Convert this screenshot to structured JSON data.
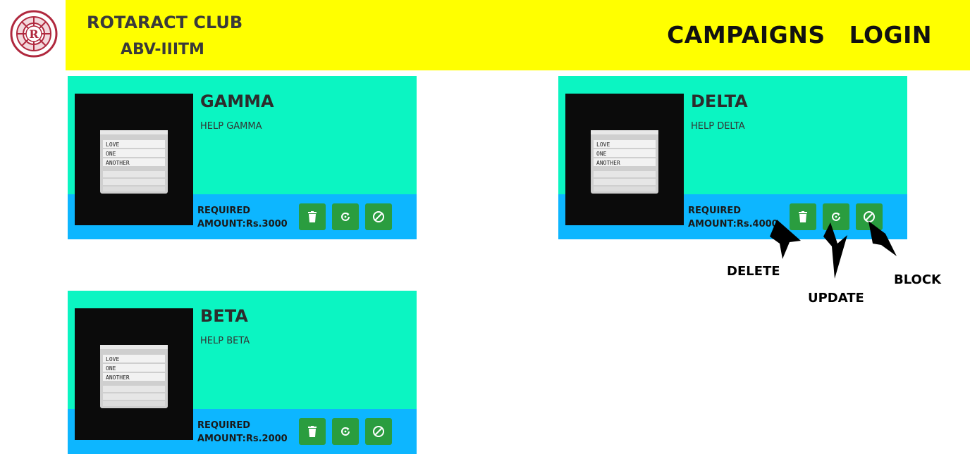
{
  "logo": {
    "icon": "rotaract-club-logo",
    "ring_text_top": "ROTARACT",
    "ring_text_bottom": "CLUB"
  },
  "header": {
    "brand_line1": "ROTARACT CLUB",
    "brand_line2": "ABV-IIITM",
    "nav": [
      {
        "label": "CAMPAIGNS"
      },
      {
        "label": "LOGIN"
      }
    ],
    "colors": {
      "background": "#ffff00"
    }
  },
  "campaigns": [
    {
      "title": "GAMMA",
      "description": "HELP GAMMA",
      "amount_line1": "REQUIRED",
      "amount_line2": "AMOUNT:Rs.3000"
    },
    {
      "title": "DELTA",
      "description": "HELP DELTA",
      "amount_line1": "REQUIRED",
      "amount_line2": "AMOUNT:Rs.4000"
    },
    {
      "title": "BETA",
      "description": "HELP BETA",
      "amount_line1": "REQUIRED",
      "amount_line2": "AMOUNT:Rs.2000"
    }
  ],
  "card_image_text": [
    "LOVE",
    "ONE",
    "ANOTHER"
  ],
  "actions": [
    {
      "name": "delete",
      "icon": "trash-icon"
    },
    {
      "name": "update",
      "icon": "refresh-icon"
    },
    {
      "name": "block",
      "icon": "block-icon"
    }
  ],
  "annotations": {
    "delete_label": "DELETE",
    "update_label": "UPDATE",
    "block_label": "BLOCK"
  },
  "colors": {
    "card_top": "#0bf5c2",
    "card_footer": "#0db6ff",
    "button": "#2a9d3f"
  }
}
